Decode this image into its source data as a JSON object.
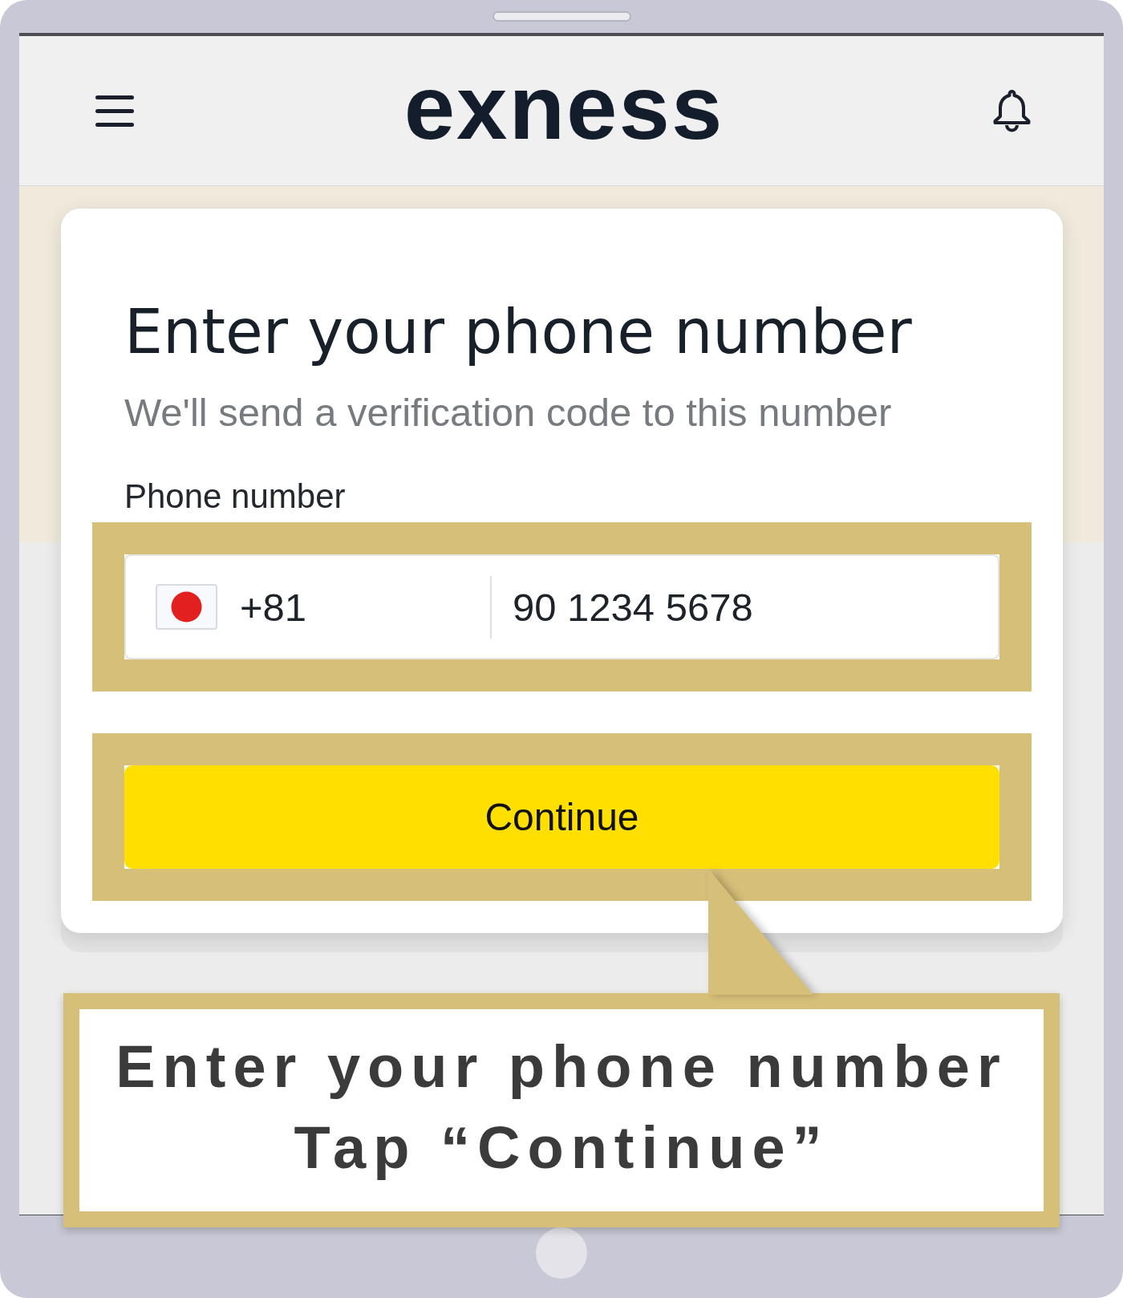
{
  "header": {
    "logo": "exness"
  },
  "card": {
    "title": "Enter your phone number",
    "subtitle": "We'll send a verification code to this number",
    "phone_field": {
      "label": "Phone number",
      "country_code": "+81",
      "value": "90 1234 5678",
      "highlighted": true
    },
    "button": {
      "label": "Continue",
      "highlighted": true
    }
  },
  "callout": {
    "lines": [
      "Enter your phone number",
      "Tap “Continue”"
    ]
  }
}
